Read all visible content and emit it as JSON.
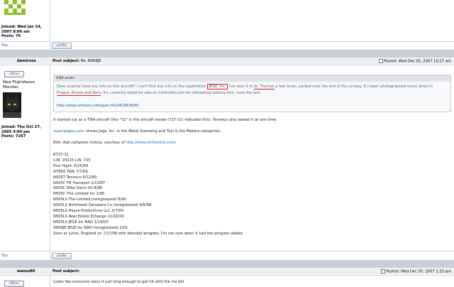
{
  "post1": {
    "joined": "Joined: Wed Jan 24, 2007 8:00 am",
    "posts": "Posts: 76",
    "top_link": "Top",
    "profile_label": "profile"
  },
  "post2": {
    "username": "damiross",
    "status": "offline",
    "rank": "New FlightAware Member",
    "joined": "Joined: Thu Oct 27, 2005 4:00 pm",
    "posts": "Posts: 7267",
    "subject_label": "Post subject:",
    "subject": "Re: N908JE",
    "posted": "Posted: Wed Dec 05, 2007 10:27 am",
    "quote_author": "SAJR wrote:",
    "quote": {
      "p1a": "Does anyone have any info on this aircraft? I can't find any info on the registration ",
      "p1_jege": "JEGE, Inc.",
      "p1b": " I've seen it in ",
      "p1_stthomas": "St. Thomas",
      "p1c": " a few times, parked near the end of the runway. It's been photographed many times in ",
      "p1_places": "Prague, Russia and Paris",
      "p1d": ". It's currently listed for sale on Controller.com An interesting looking bird, none the less.",
      "url": "http://www.airliners.net/open.file/0628838/M/"
    },
    "body": {
      "p1": "It started out as a TWA aircraft (the \"31\" in the aircraft model (727-31) indicates this). Tenneco also owned it at one time.",
      "p2_link": "superpages.com",
      "p2_rest": ", shows Jege, Inc. in the Metal Stamping and Tool & Die Makers categories.",
      "p3_text": "Edit: Add complete history, courtesy of ",
      "p3_link": "http://www.airlinerlist.com/",
      "history": [
        "B727-31",
        "C/N: 20115 L/N: 735",
        "First flight: 6/25/69",
        "N7893 TWA 7/7/69",
        "N505T Tenneco 9/12/80",
        "N505C FB Transport 1/13/87",
        "N505C Mike Davis Oil 8/88",
        "N505C The Limited Inc 1/90",
        "N500LS The Limited (reregistered) 8/90",
        "N505LS Northwest Delaware Co (reregistered) 8/6/98",
        "N505LS Hayes Productions LLC 2/7/00",
        "N505LS Real Estate Echange 11/16/00",
        "N505LS JEGE Inc NAO 1/19/00",
        "N908JE JEGE Inc NAO (reregistered) 2/01",
        "Seen at Luton, England on 7/17/06 with blended winglets. I'm not sure when it had the winglets added."
      ]
    },
    "top_link": "Top",
    "profile_label": "profile"
  },
  "post3": {
    "username": "wazzu90",
    "status": "offline",
    "subject_label": "Post subject:",
    "posted": "Posted: Wed Dec 05, 2007 1:33 pm",
    "body": "Looks like everyone owns it just long enough to get hit with the mx bill."
  },
  "colors": {
    "link": "#1f5fb0",
    "highlight_red": "#d51a1a",
    "avatar_green": "#8fbf2a",
    "offline_red": "#c0242b"
  }
}
